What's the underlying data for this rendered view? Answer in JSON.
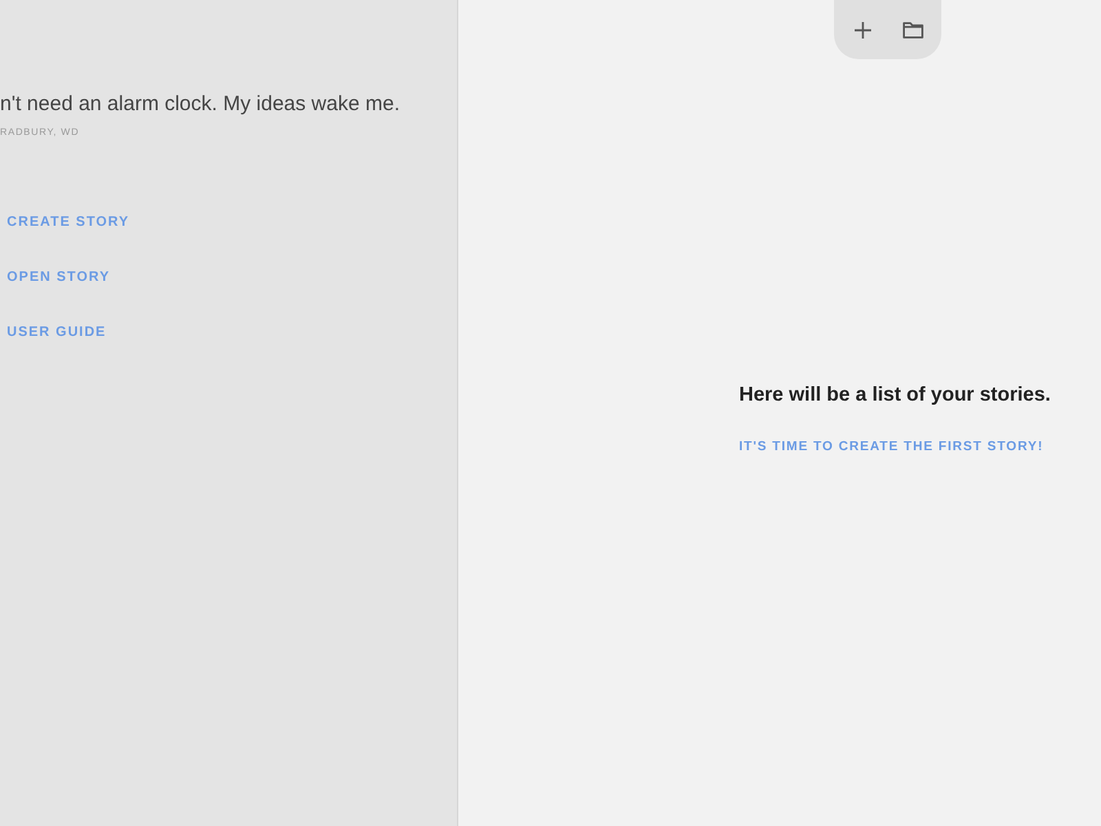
{
  "quote": {
    "text": "n't need an alarm clock. My ideas wake me.",
    "author": "RADBURY, WD"
  },
  "menu": [
    {
      "label": "CREATE STORY"
    },
    {
      "label": "OPEN STORY"
    },
    {
      "label": "USER GUIDE"
    }
  ],
  "empty_state": {
    "message": "Here will be a list of your stories.",
    "action": "IT'S TIME TO CREATE THE FIRST STORY!"
  }
}
